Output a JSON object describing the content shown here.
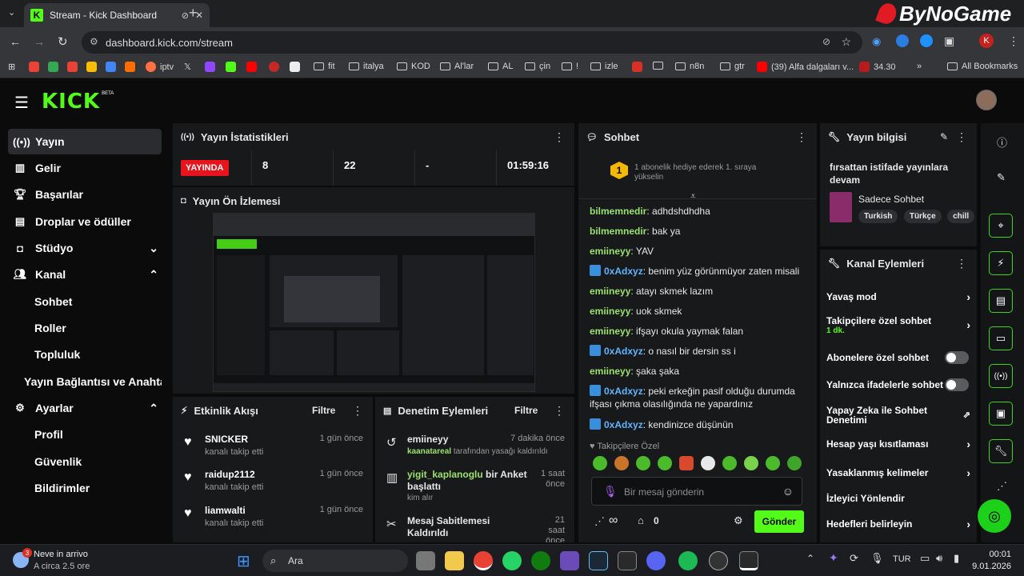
{
  "browser": {
    "tab_title": "Stream - Kick Dashboard",
    "url": "dashboard.kick.com/stream",
    "watermark": "ByNoGame",
    "profile_initial": "K",
    "bookmarks": [
      "iptv",
      "fit",
      "italya",
      "KOD",
      "Al'lar",
      "AL",
      "çin",
      "!",
      "izle",
      "n8n",
      "gtr",
      "(39) Alfa dalgaları v...",
      "34.30"
    ],
    "all_bookmarks": "All Bookmarks"
  },
  "app": {
    "logo": "KICK",
    "logo_badge": "BETA"
  },
  "sidebar": {
    "items": [
      {
        "label": "Yayın",
        "icon": "broadcast-icon"
      },
      {
        "label": "Gelir",
        "icon": "chart-icon"
      },
      {
        "label": "Başarılar",
        "icon": "trophy-icon"
      },
      {
        "label": "Droplar ve ödüller",
        "icon": "gift-icon"
      },
      {
        "label": "Stüdyo",
        "icon": "studio-icon"
      },
      {
        "label": "Kanal",
        "icon": "users-icon"
      },
      {
        "label": "Sohbet"
      },
      {
        "label": "Roller"
      },
      {
        "label": "Topluluk"
      },
      {
        "label": "Yayın Bağlantısı ve Anahtarı"
      },
      {
        "label": "Ayarlar",
        "icon": "gear-icon"
      },
      {
        "label": "Profil"
      },
      {
        "label": "Güvenlik"
      },
      {
        "label": "Bildirimler"
      }
    ]
  },
  "stats": {
    "title": "Yayın İstatistikleri",
    "live_label": "YAYINDA",
    "viewers": "8",
    "followers": "22",
    "dash": "-",
    "duration": "01:59:16"
  },
  "preview": {
    "title": "Yayın Ön İzlemesi"
  },
  "activity": {
    "title": "Etkinlik Akışı",
    "filter": "Filtre",
    "items": [
      {
        "name": "SNICKER",
        "sub": "kanalı takip etti",
        "time": "1 gün önce"
      },
      {
        "name": "raidup2112",
        "sub": "kanalı takip etti",
        "time": "1 gün önce"
      },
      {
        "name": "liamwalti",
        "sub": "kanalı takip etti",
        "time": "1 gün önce"
      }
    ]
  },
  "moderation": {
    "title": "Denetim Eylemleri",
    "filter": "Filtre",
    "items": [
      {
        "name": "emiineyy",
        "sub_user": "kaanatareal",
        "sub": "tarafından yasağı kaldırıldı",
        "time": "7 dakika önce"
      },
      {
        "name_user": "yigit_kaplanoglu",
        "name": "bir Anket başlattı",
        "sub": "kim alır",
        "time": "1 saat önce"
      },
      {
        "name": "Mesaj Sabitlemesi Kaldırıldı",
        "time": "21 saat önce"
      }
    ]
  },
  "chat": {
    "title": "Sohbet",
    "pinned_rank": "1",
    "pinned_text": "1 abonelik hediye ederek 1. sıraya yükselin",
    "messages": [
      {
        "user": "bilmemnedir",
        "text": "adhdshdhdha",
        "color": "g"
      },
      {
        "user": "bilmemnedir",
        "text": "bak ya",
        "color": "g"
      },
      {
        "user": "emiineyy",
        "text": "YAV",
        "color": "g"
      },
      {
        "user": "0xAdxyz",
        "text": "benim yüz görünmüyor zaten misali",
        "color": "b"
      },
      {
        "user": "emiineyy",
        "text": "atayı skmek lazım",
        "color": "g"
      },
      {
        "user": "emiineyy",
        "text": "uok skmek",
        "color": "g"
      },
      {
        "user": "emiineyy",
        "text": "ifşayı okula yaymak falan",
        "color": "g"
      },
      {
        "user": "0xAdxyz",
        "text": "o nasıl bir dersin ss i",
        "color": "b"
      },
      {
        "user": "emiineyy",
        "text": "şaka şaka",
        "color": "g"
      },
      {
        "user": "0xAdxyz",
        "text": "peki erkeğin pasif olduğu durumda ifşası çıkma olasılığında ne yapardınız",
        "color": "b"
      },
      {
        "user": "0xAdxyz",
        "text": "kendinizce düşünün",
        "color": "b"
      }
    ],
    "followers_only": "Takipçilere Özel",
    "placeholder": "Bir mesaj gönderin",
    "infinity": "∞",
    "gift_count": "0",
    "send": "Gönder"
  },
  "stream_info": {
    "title": "Yayın bilgisi",
    "stream_title": "fırsattan istifade yayınlara devam",
    "category": "Sadece Sohbet",
    "tags": [
      "Turkish",
      "Türkçe",
      "chill"
    ]
  },
  "channel_actions": {
    "title": "Kanal Eylemleri",
    "slow_mode": "Yavaş mod",
    "followers_chat": "Takipçilere özel sohbet",
    "followers_chat_value": "1 dk.",
    "subs_chat": "Abonelere özel sohbet",
    "emote_only": "Yalnızca ifadelerle sohbet",
    "ai_mod": "Yapay Zeka ile Sohbet Denetimi",
    "age_limit": "Hesap yaşı kısıtlaması",
    "banned_words": "Yasaklanmış kelimeler",
    "viewer_redirect": "İzleyici Yönlendir",
    "goals": "Hedefleri belirleyin"
  },
  "taskbar": {
    "weather_title": "Neve in arrivo",
    "weather_sub": "A circa 2.5 ore",
    "weather_badge": "3",
    "search": "Ara",
    "lang": "TUR",
    "time": "00:01",
    "date": "9.01.2026"
  },
  "colors": {
    "accent": "#53fc18",
    "live": "#e8141b"
  }
}
